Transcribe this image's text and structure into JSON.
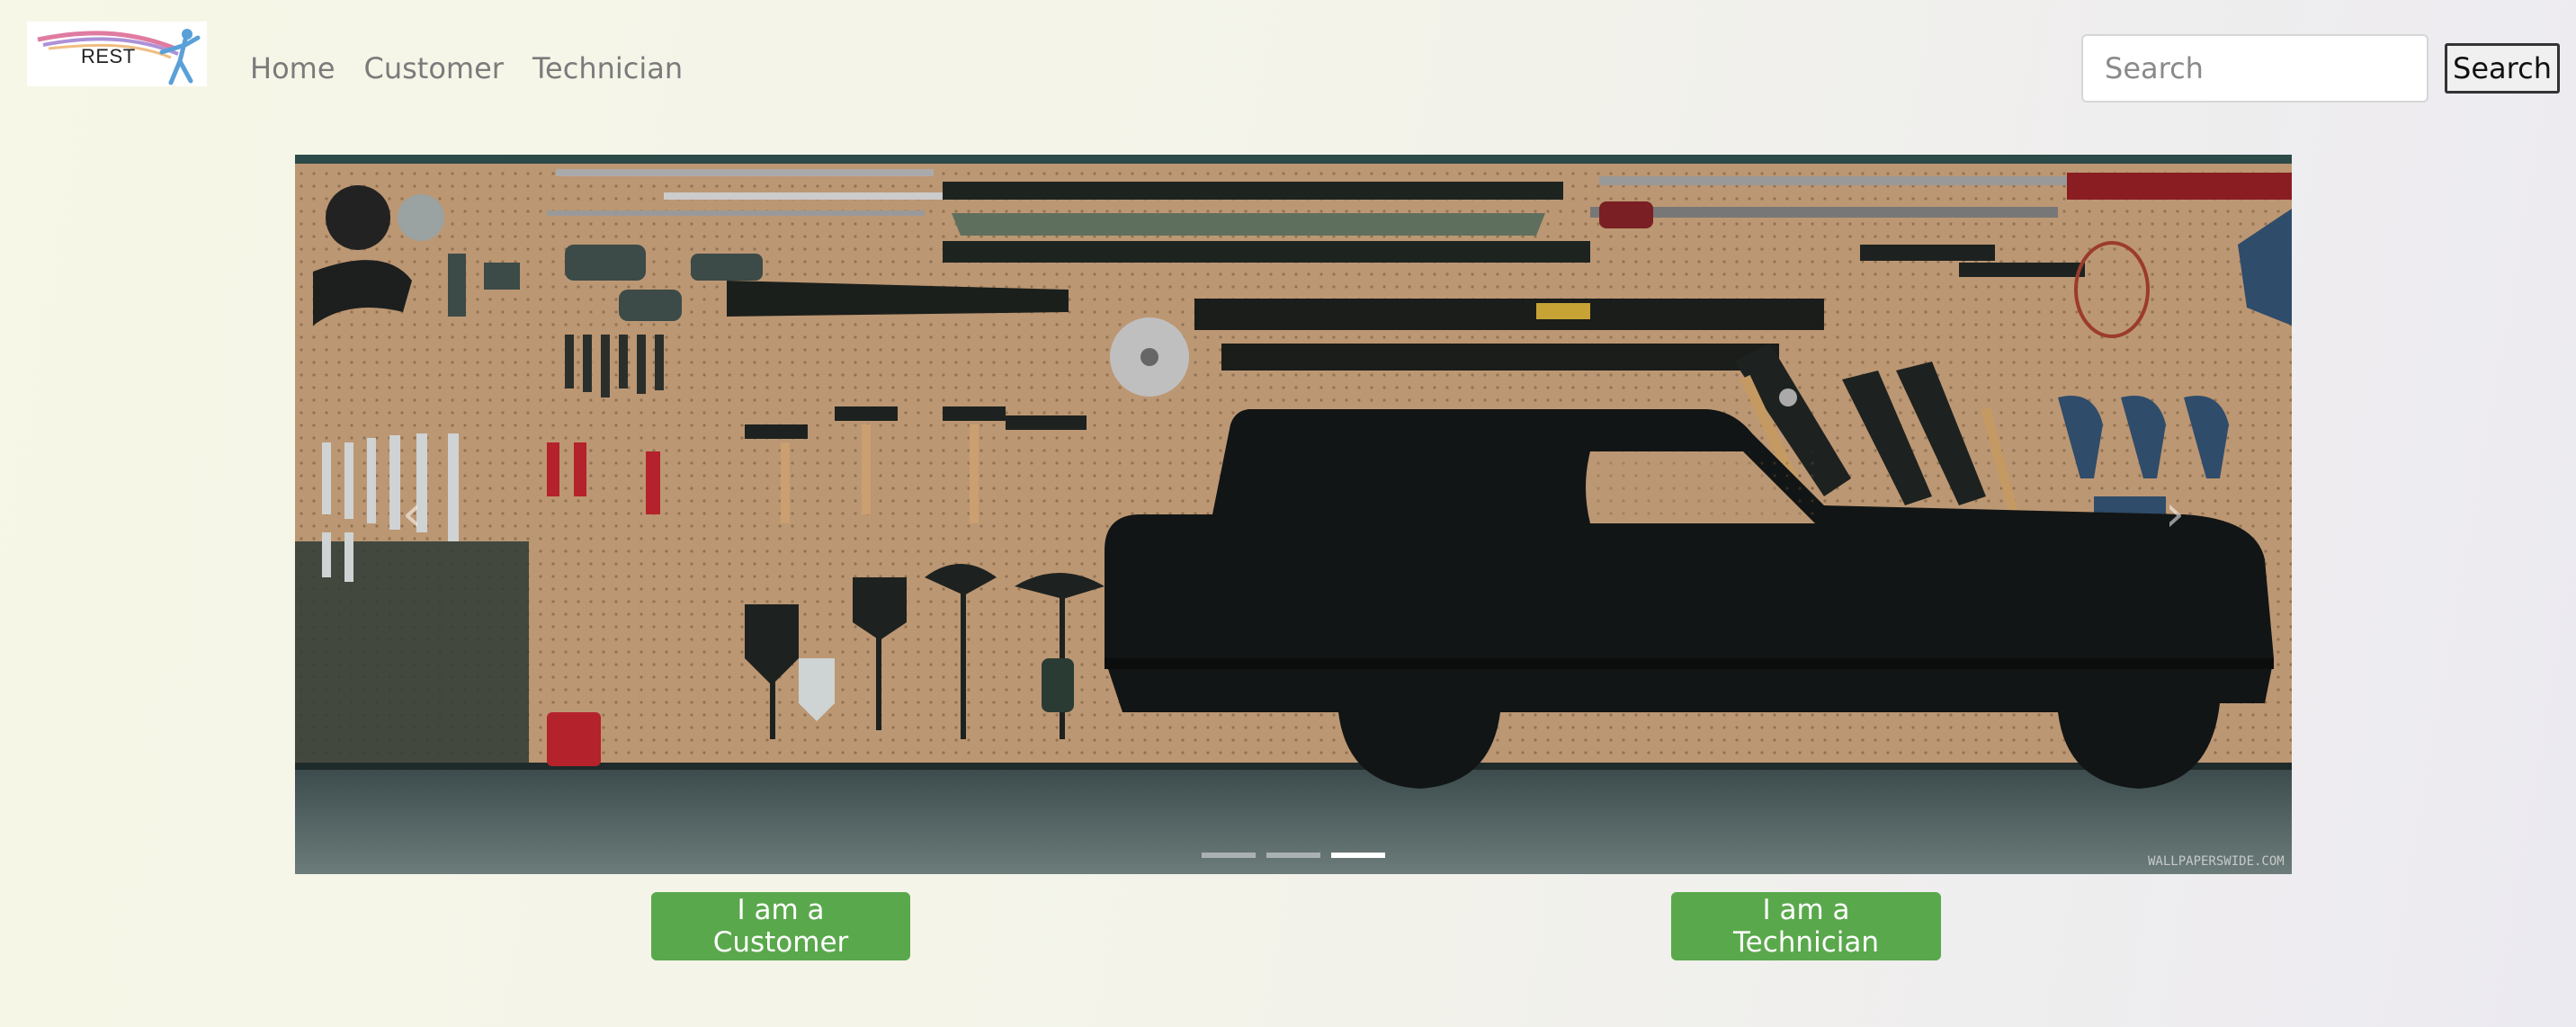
{
  "brand": {
    "logo_text": "REST",
    "icon": "dancer-logo-icon"
  },
  "nav": {
    "items": [
      {
        "label": "Home"
      },
      {
        "label": "Customer"
      },
      {
        "label": "Technician"
      }
    ]
  },
  "search": {
    "placeholder": "Search",
    "value": "",
    "button_label": "Search"
  },
  "carousel": {
    "slide_count": 3,
    "active_slide": 3,
    "prev_icon": "chevron-left-icon",
    "next_icon": "chevron-right-icon",
    "image_watermark": "WALLPAPERSWIDE.COM"
  },
  "actions": {
    "customer_label": "I am a Customer",
    "technician_label": "I am a Technician"
  },
  "colors": {
    "cta_green": "#5aa84c",
    "nav_text": "#7b7b7b",
    "board_tan": "#b89371"
  }
}
